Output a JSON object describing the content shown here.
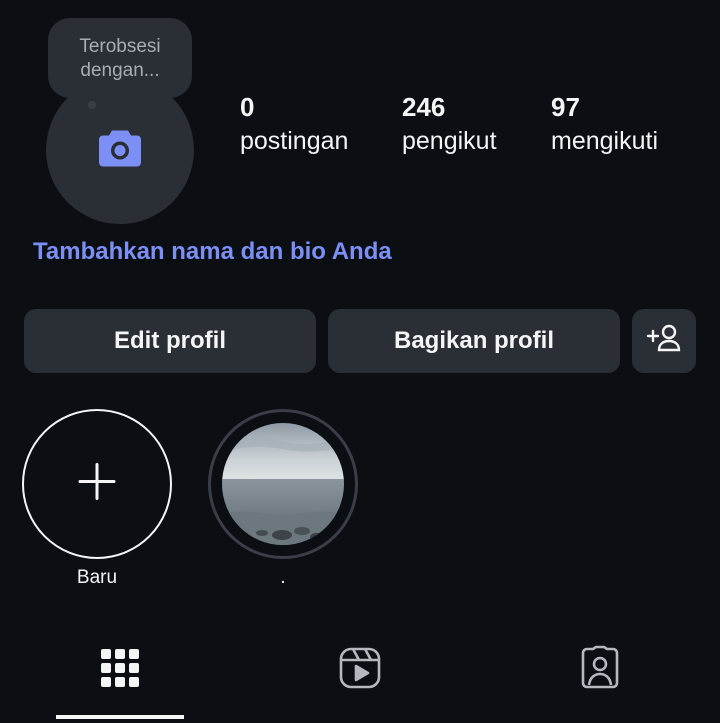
{
  "profile": {
    "note_text": "Terobsesi dengan...",
    "stats": [
      {
        "value": "0",
        "label": "postingan"
      },
      {
        "value": "246",
        "label": "pengikut"
      },
      {
        "value": "97",
        "label": "mengikuti"
      }
    ],
    "bio_prompt": "Tambahkan nama dan bio Anda"
  },
  "actions": {
    "edit_label": "Edit profil",
    "share_label": "Bagikan profil",
    "discover_icon": "person-add-icon"
  },
  "highlights": [
    {
      "label": "Baru",
      "icon": "plus-icon"
    },
    {
      "label": ".",
      "icon": "sea-thumbnail"
    }
  ],
  "tabs": [
    {
      "name": "grid",
      "icon": "grid-icon",
      "selected": true
    },
    {
      "name": "reels",
      "icon": "reels-icon",
      "selected": false
    },
    {
      "name": "tagged",
      "icon": "tagged-person-icon",
      "selected": false
    }
  ],
  "colors": {
    "background": "#0b0e13",
    "surface": "#2a2e35",
    "accent": "#7c8ff5",
    "text": "#f3f5f7"
  }
}
